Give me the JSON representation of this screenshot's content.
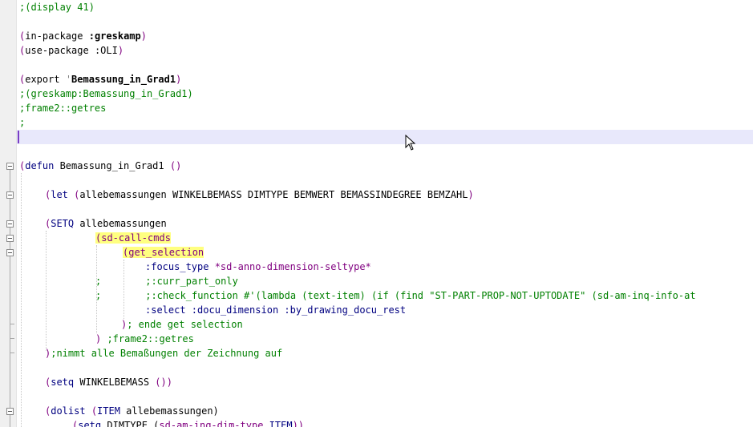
{
  "editor": {
    "lines": {
      "l1": ";(display 41)",
      "l2a": "(",
      "l2b": "in-package ",
      "l2c": ":greskamp",
      "l2d": ")",
      "l3a": "(",
      "l3b": "use-package ",
      "l3c": ":OLI",
      "l3d": ")",
      "l4a": "(",
      "l4b": "export ",
      "l4c": "'",
      "l4d": "Bemassung_in_Grad1",
      "l4e": ")",
      "l5": ";(greskamp:Bemassung_in_Grad1)",
      "l6": ";frame2::getres",
      "l7": ";",
      "l8a": "(",
      "l8b": "defun",
      "l8c": " Bemassung_in_Grad1 ",
      "l8d": "()",
      "l9a": "(",
      "l9b": "let",
      "l9c": " (",
      "l9d": "allebemassungen WINKELBEMASS DIMTYPE BEMWERT BEMASSINDEGREE BEMZAHL",
      "l9e": ")",
      "l10a": "(",
      "l10b": "SETQ",
      "l10c": " allebemassungen",
      "l11a": "(",
      "l11b": "sd-call-cmds",
      "l12a": "(",
      "l12b": "get_selection",
      "l13a": ":focus_type",
      "l13b": " *sd-anno-dimension-seltype*",
      "l14a": ";",
      "l14b": ";:curr_part_only",
      "l15a": ";",
      "l15b": ";:check_function #'(lambda (text-item) (if (find \"ST-PART-PROP-NOT-UPTODATE\" (sd-am-inq-info-at",
      "l16a": ":select",
      "l16b": " :docu_dimension :by_drawing_docu_rest",
      "l17a": ")",
      "l17b": "; ende get selection",
      "l18a": ")",
      "l18b": " ;frame2::getres",
      "l19a": ")",
      "l19b": ";nimmt alle Bemaßungen der Zeichnung auf",
      "l20a": "(",
      "l20b": "setq",
      "l20c": " WINKELBEMASS ",
      "l20d": "())",
      "l21a": "(",
      "l21b": "dolist",
      "l21c": " (",
      "l21d": "ITEM",
      "l21e": " allebemassungen)",
      "l22a": "(",
      "l22b": "setq",
      "l22c": " DIMTYPE (",
      "l22d": "sd-am-inq-dim-type",
      "l22e": " ITEM",
      "l22f": "))"
    }
  },
  "colors": {
    "comment": "#008000",
    "paren": "#800080",
    "keyword": "#000080",
    "highlight": "#ffff80",
    "caret_line": "#e8e8fb"
  },
  "icons": {
    "cursor": "mouse-pointer-icon",
    "fold": "fold-minus-icon"
  }
}
